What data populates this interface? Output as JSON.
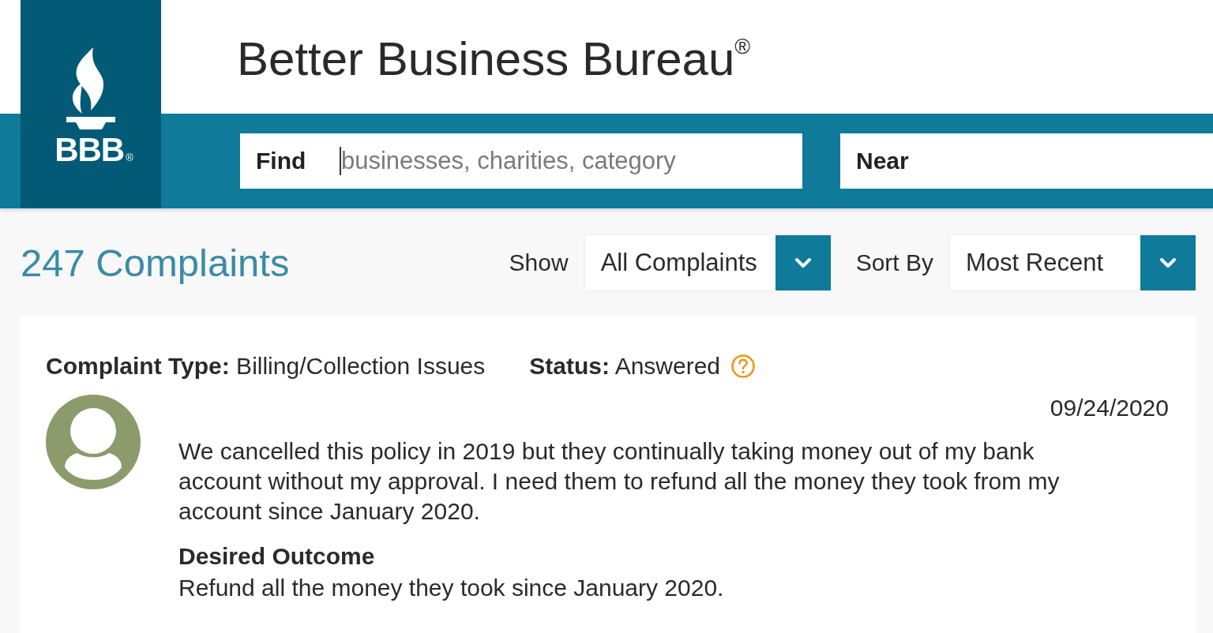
{
  "header": {
    "title": "Better Business Bureau$^{®}$",
    "logo_text": "BBB$_{®}$"
  },
  "search": {
    "find": {
      "label": "Find",
      "placeholder": "businesses, charities, category",
      "focused": true
    },
    "near": {
      "label": "Near"
    }
  },
  "complaints": {
    "heading": "247 Complaints",
    "filters": [
      {
        "label": "Show",
        "value": "All Complaints"
      },
      {
        "label": "Sort By",
        "value": "Most Recent"
      }
    ]
  },
  "complaint": {
    "type": "**Complaint Type:** Billing/Collection Issues",
    "status": "**Status:** Answered",
    "date": "09/24/2020",
    "text": "We cancelled this policy in 2019 but they continually taking money out of my bank account without my approval. I need them to refund all the money they took from my account since January 2020.",
    "desired_outcome_heading": "Desired Outcome",
    "desired_outcome": "Refund all the money they took since January 2020."
  }
}
